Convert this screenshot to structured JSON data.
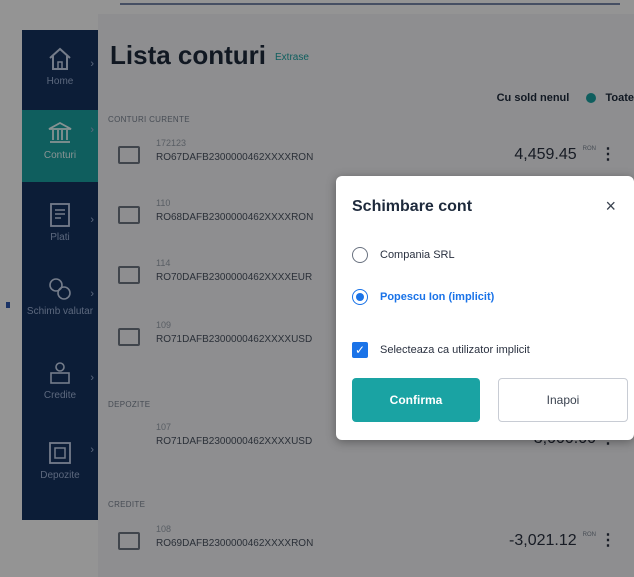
{
  "header": {
    "title": "Lista conturi",
    "extrase_link": "Extrase"
  },
  "sidebar": {
    "items": [
      {
        "label": "Home",
        "icon": "home-icon"
      },
      {
        "label": "Conturi",
        "icon": "bank-icon",
        "active": true
      },
      {
        "label": "Plati",
        "icon": "document-icon"
      },
      {
        "label": "Schimb valutar",
        "icon": "exchange-icon"
      },
      {
        "label": "Credite",
        "icon": "credit-icon"
      },
      {
        "label": "Depozite",
        "icon": "deposit-icon"
      }
    ]
  },
  "filters": {
    "cu_sold_nenul": "Cu sold nenul",
    "toate": "Toate",
    "accent": "#1aa3a3"
  },
  "sections": {
    "curente": "CONTURI CURENTE",
    "depozite": "DEPOZITE",
    "credite": "CREDITE"
  },
  "accounts": [
    {
      "number": "172123",
      "iban": "RO67DAFB2300000462XXXXRON",
      "amount": "4,459.45",
      "currency": "RON"
    },
    {
      "number": "110",
      "iban": "RO68DAFB2300000462XXXXRON",
      "amount": "",
      "currency": ""
    },
    {
      "number": "114",
      "iban": "RO70DAFB2300000462XXXXEUR",
      "amount": "",
      "currency": ""
    },
    {
      "number": "109",
      "iban": "RO71DAFB2300000462XXXXUSD",
      "amount": "",
      "currency": ""
    }
  ],
  "deposits": [
    {
      "number": "107",
      "iban": "RO71DAFB2300000462XXXXUSD",
      "amount": "3,000.00",
      "currency": ""
    }
  ],
  "credits": [
    {
      "number": "108",
      "iban": "RO69DAFB2300000462XXXXRON",
      "amount": "-3,021.12",
      "currency": "RON"
    }
  ],
  "modal": {
    "title": "Schimbare cont",
    "close": "×",
    "options": [
      {
        "label": "Compania SRL",
        "selected": false
      },
      {
        "label": "Popescu Ion (implicit)",
        "selected": true
      }
    ],
    "checkbox_label": "Selecteaza ca utilizator implicit",
    "checkbox_checked": true,
    "confirm": "Confirma",
    "back": "Inapoi"
  },
  "colors": {
    "sidebar": "#15325f",
    "accent": "#1aa3a3",
    "selected": "#1a73e8"
  }
}
